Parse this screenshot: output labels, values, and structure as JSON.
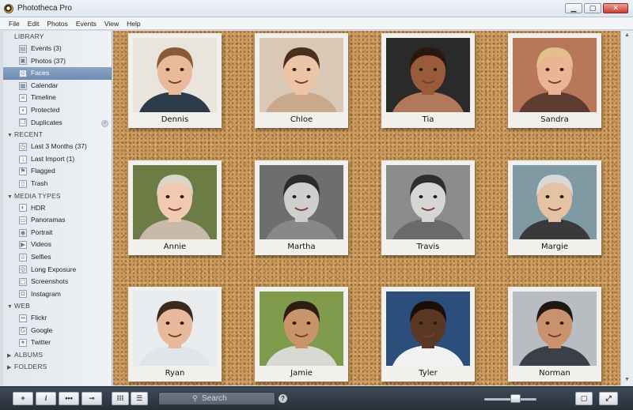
{
  "window": {
    "title": "Phototheca Pro",
    "minimize": "▁",
    "maximize": "▢",
    "close": "✕"
  },
  "menu": [
    "File",
    "Edit",
    "Photos",
    "Events",
    "View",
    "Help"
  ],
  "sidebar": {
    "sections": [
      {
        "title": "LIBRARY",
        "items": [
          {
            "label": "Events (3)",
            "icon": "events-icon",
            "glyph": "▤"
          },
          {
            "label": "Photos (37)",
            "icon": "photos-icon",
            "glyph": "▣"
          },
          {
            "label": "Faces",
            "icon": "faces-icon",
            "glyph": "☺",
            "selected": true
          },
          {
            "label": "Calendar",
            "icon": "calendar-icon",
            "glyph": "▦"
          },
          {
            "label": "Timeline",
            "icon": "timeline-icon",
            "glyph": "≡"
          },
          {
            "label": "Protected",
            "icon": "lock-icon",
            "glyph": "▪"
          },
          {
            "label": "Duplicates",
            "icon": "duplicates-icon",
            "glyph": "❐"
          }
        ]
      },
      {
        "title": "RECENT",
        "items": [
          {
            "label": "Last 3 Months (37)",
            "icon": "clock-icon",
            "glyph": "◷"
          },
          {
            "label": "Last Import (1)",
            "icon": "import-icon",
            "glyph": "↓"
          },
          {
            "label": "Flagged",
            "icon": "flag-icon",
            "glyph": "⚑"
          },
          {
            "label": "Trash",
            "icon": "trash-icon",
            "glyph": "▯"
          }
        ]
      },
      {
        "title": "MEDIA TYPES",
        "items": [
          {
            "label": "HDR",
            "icon": "hdr-icon",
            "glyph": "◐"
          },
          {
            "label": "Panoramas",
            "icon": "panorama-icon",
            "glyph": "▭"
          },
          {
            "label": "Portrait",
            "icon": "portrait-icon",
            "glyph": "◉"
          },
          {
            "label": "Videos",
            "icon": "video-icon",
            "glyph": "▶"
          },
          {
            "label": "Selfies",
            "icon": "selfie-icon",
            "glyph": "☺"
          },
          {
            "label": "Long Exposure",
            "icon": "long-exposure-icon",
            "glyph": "◎"
          },
          {
            "label": "Screenshots",
            "icon": "screenshot-icon",
            "glyph": "▢"
          },
          {
            "label": "Instagram",
            "icon": "instagram-icon",
            "glyph": "◘"
          }
        ]
      },
      {
        "title": "WEB",
        "items": [
          {
            "label": "Flickr",
            "icon": "flickr-icon",
            "glyph": "••"
          },
          {
            "label": "Google",
            "icon": "google-icon",
            "glyph": "G"
          },
          {
            "label": "Twitter",
            "icon": "twitter-icon",
            "glyph": "✦"
          }
        ]
      },
      {
        "title": "ALBUMS",
        "collapsed": true,
        "items": []
      },
      {
        "title": "FOLDERS",
        "collapsed": true,
        "items": []
      }
    ]
  },
  "faces": [
    {
      "name": "Dennis",
      "bg": "#e9e4dc",
      "skin": "#e9b99a",
      "hair": "#8a5a36",
      "shirt": "#2d3a48"
    },
    {
      "name": "Chloe",
      "bg": "#d9c8b6",
      "skin": "#eec4a6",
      "hair": "#4a2e1e",
      "shirt": "#c9a98a"
    },
    {
      "name": "Tia",
      "bg": "#2b2a2a",
      "skin": "#9a5b3a",
      "hair": "#2a1810",
      "shirt": "#b07a5a"
    },
    {
      "name": "Sandra",
      "bg": "#b9775a",
      "skin": "#eab594",
      "hair": "#e2c08a",
      "shirt": "#5e3b30"
    },
    {
      "name": "Annie",
      "bg": "#6d7b44",
      "skin": "#f0c9b0",
      "hair": "#ddd4c8",
      "shirt": "#c9b9a9"
    },
    {
      "name": "Martha",
      "bg": "#6e6e6e",
      "skin": "#cfcfcf",
      "hair": "#2b2b2b",
      "shirt": "#888888"
    },
    {
      "name": "Travis",
      "bg": "#8c8c8c",
      "skin": "#d6d6d6",
      "hair": "#2e2e2e",
      "shirt": "#6a6a6a"
    },
    {
      "name": "Margie",
      "bg": "#7f9aa3",
      "skin": "#e6c2a4",
      "hair": "#d8d8d8",
      "shirt": "#3a3a3a"
    },
    {
      "name": "Ryan",
      "bg": "#e8ecef",
      "skin": "#e7b89a",
      "hair": "#3a2a1f",
      "shirt": "#dfe5ea"
    },
    {
      "name": "Jamie",
      "bg": "#7e9a4a",
      "skin": "#c8946a",
      "hair": "#2e1e12",
      "shirt": "#d9d9d4"
    },
    {
      "name": "Tyler",
      "bg": "#2b4f7a",
      "skin": "#5a3624",
      "hair": "#1a0f08",
      "shirt": "#f2f2f2"
    },
    {
      "name": "Norman",
      "bg": "#b9bcc0",
      "skin": "#c9916c",
      "hair": "#1f1712",
      "shirt": "#3a3f48"
    }
  ],
  "toolbar": {
    "add_label": "+",
    "info_label": "i",
    "more_label": "•••",
    "key_label": "⊸",
    "grid_label": "⁞⁞⁞",
    "list_label": "☰",
    "search_placeholder": "Search",
    "help_label": "?",
    "frame_label": "▢",
    "fullscreen_label": "⤢"
  }
}
